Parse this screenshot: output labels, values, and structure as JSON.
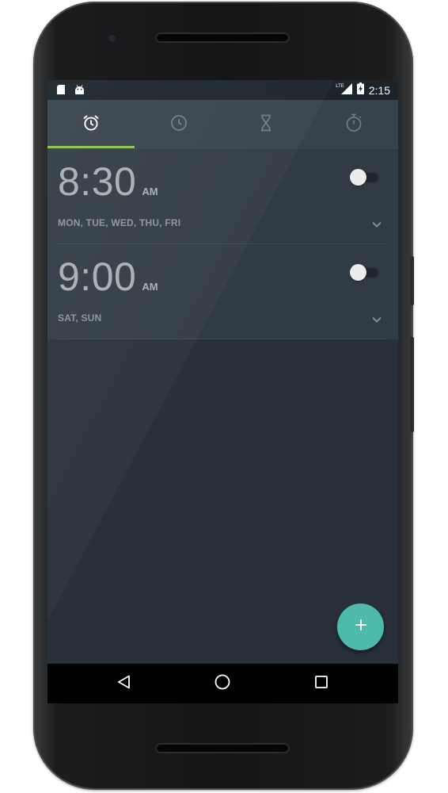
{
  "status_bar": {
    "time": "2:15",
    "network_label": "LTE",
    "icons": [
      "sd-card-icon",
      "android-icon",
      "signal-icon",
      "battery-charging-icon"
    ]
  },
  "tabs": [
    {
      "icon": "alarm-icon",
      "selected": true
    },
    {
      "icon": "clock-icon",
      "selected": false
    },
    {
      "icon": "hourglass-icon",
      "selected": false
    },
    {
      "icon": "stopwatch-icon",
      "selected": false
    }
  ],
  "alarms": [
    {
      "time": "8:30",
      "ampm": "AM",
      "days": "MON, TUE, WED, THU, FRI",
      "enabled": false
    },
    {
      "time": "9:00",
      "ampm": "AM",
      "days": "SAT, SUN",
      "enabled": false
    }
  ],
  "fab": {
    "icon": "plus-icon"
  },
  "navbar": {
    "icons": [
      "back-icon",
      "home-icon",
      "recents-icon"
    ]
  },
  "colors": {
    "screen_bg": "#28303a",
    "tabbar_bg": "#37424c",
    "tab_indicator": "#8bc34a",
    "alarm_bg": "#313b45",
    "fab": "#4dbaab",
    "status_bar": "#1b232b"
  }
}
